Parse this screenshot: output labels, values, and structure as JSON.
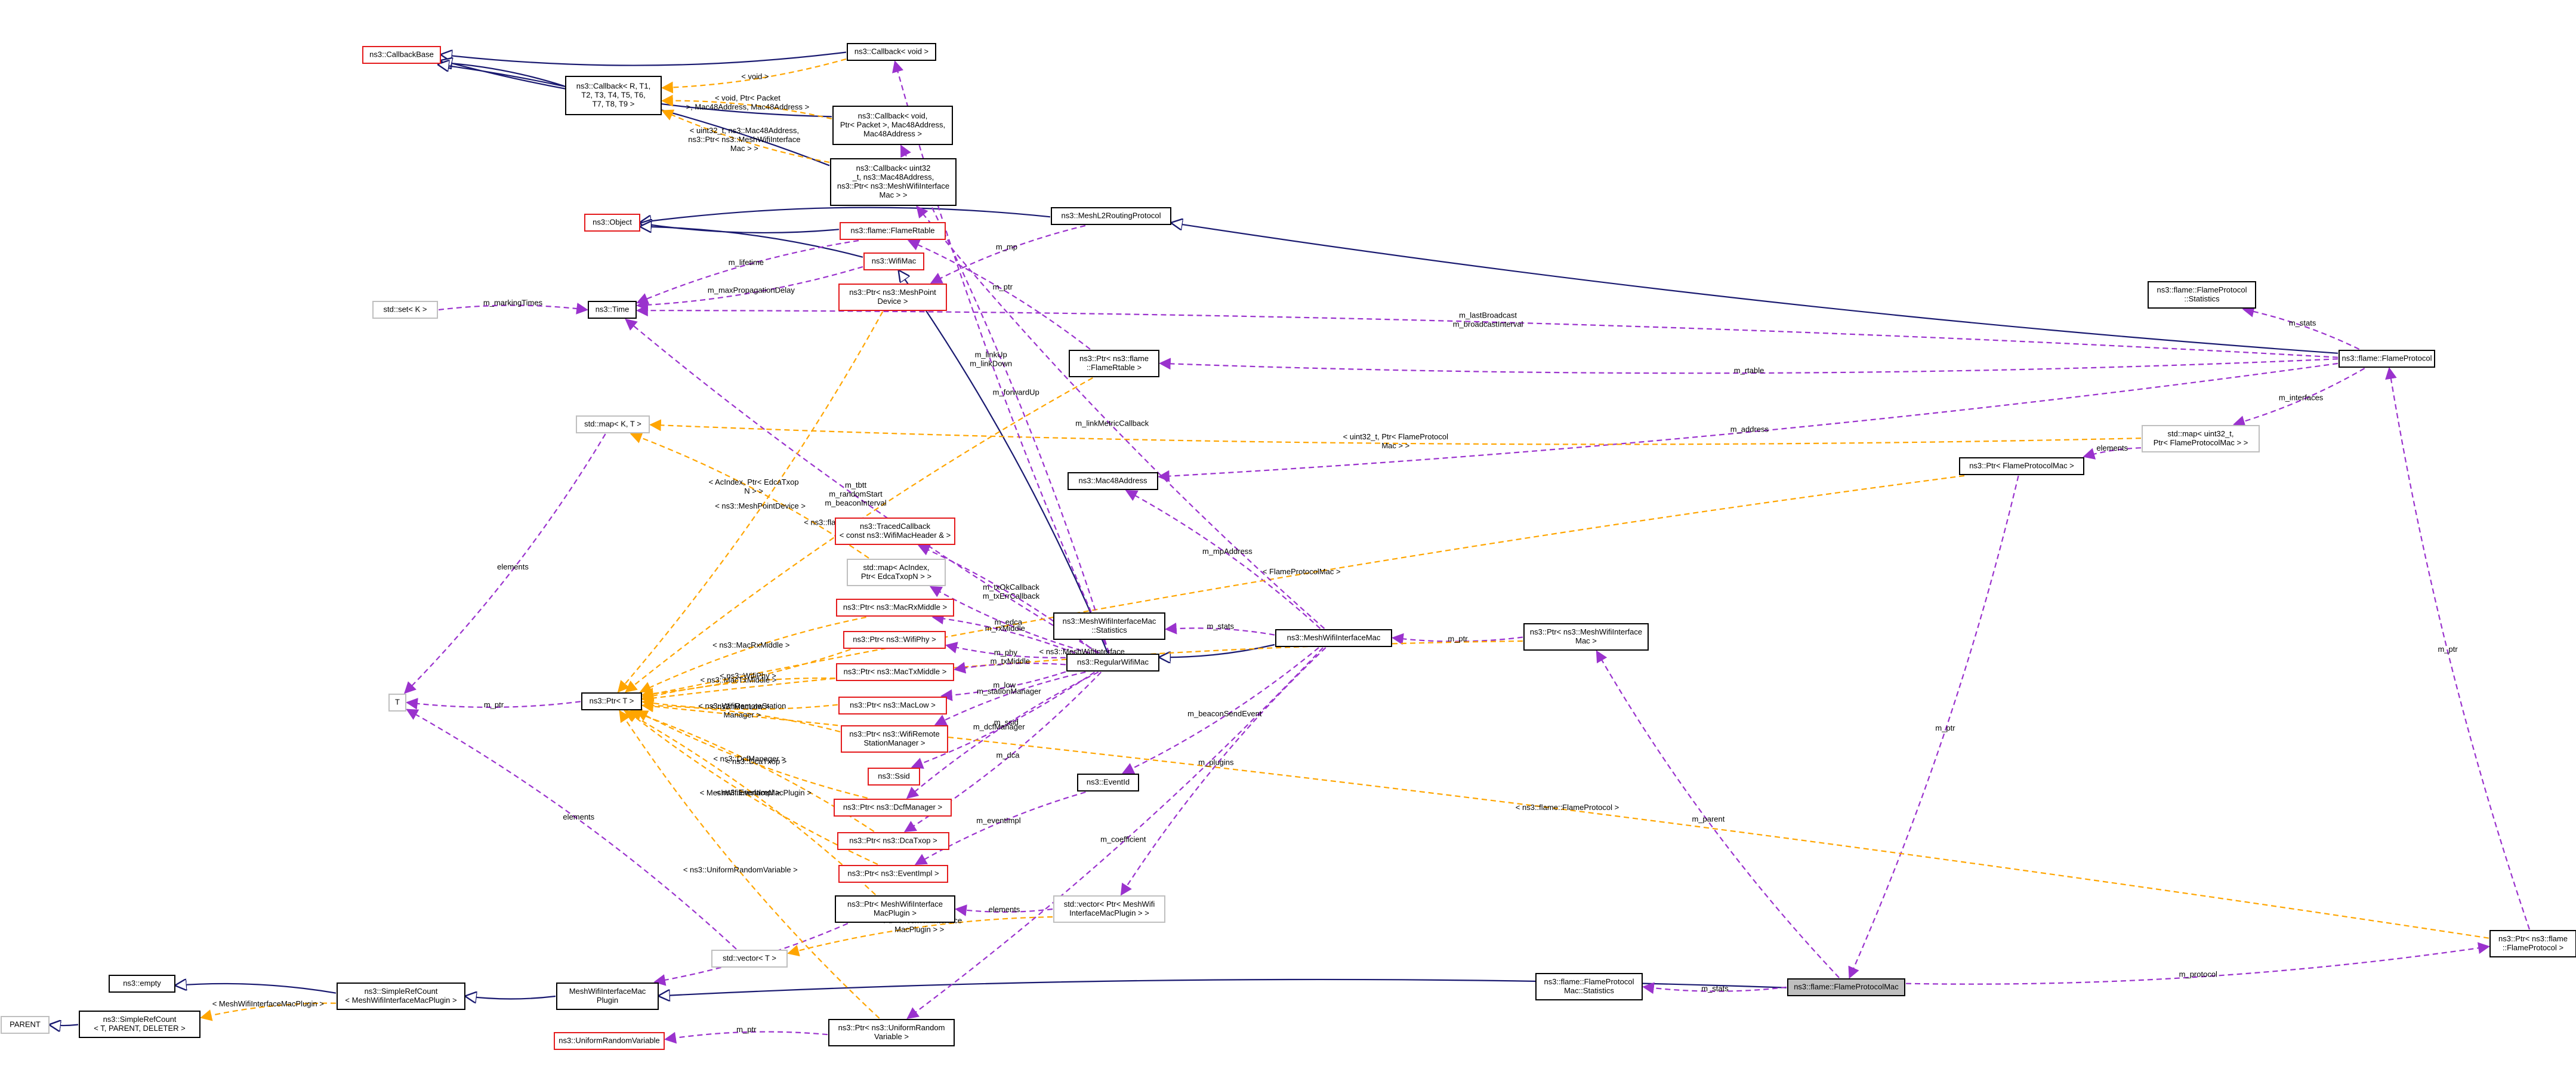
{
  "colors": {
    "inheritance": "#191970",
    "usage": "#9a32cd",
    "template": "#ffa500",
    "box_border": "#000000",
    "box_border_undocumented": "#e41a1c",
    "box_border_external": "#bfbfbf",
    "focus_fill": "#bfbfbf"
  },
  "nodes": [
    {
      "id": "CallbackBase",
      "style": "red",
      "lines": [
        "ns3::CallbackBase"
      ]
    },
    {
      "id": "CallbackVoid",
      "style": "black",
      "lines": [
        "ns3::Callback< void >"
      ]
    },
    {
      "id": "CallbackTemplate",
      "style": "black",
      "lines": [
        "ns3::Callback< R, T1,",
        "T2, T3, T4, T5, T6,",
        "T7, T8, T9 >"
      ]
    },
    {
      "id": "CallbackPacket",
      "style": "black",
      "lines": [
        "ns3::Callback< void,",
        "Ptr< Packet >, Mac48Address,",
        "Mac48Address >"
      ]
    },
    {
      "id": "CallbackUint32",
      "style": "black",
      "lines": [
        "ns3::Callback< uint32",
        "_t, ns3::Mac48Address,",
        "ns3::Ptr< ns3::MeshWifiInterface",
        "Mac > >"
      ]
    },
    {
      "id": "Object",
      "style": "red",
      "lines": [
        "ns3::Object"
      ]
    },
    {
      "id": "FlameRtable",
      "style": "red",
      "lines": [
        "ns3::flame::FlameRtable"
      ]
    },
    {
      "id": "WifiMac",
      "style": "red",
      "lines": [
        "ns3::WifiMac"
      ]
    },
    {
      "id": "MeshL2RoutingProtocol",
      "style": "black",
      "lines": [
        "ns3::MeshL2RoutingProtocol"
      ]
    },
    {
      "id": "FlameProtocolStatistics",
      "style": "black",
      "lines": [
        "ns3::flame::FlameProtocol",
        "::Statistics"
      ]
    },
    {
      "id": "PtrMeshPointDevice",
      "style": "red",
      "lines": [
        "ns3::Ptr< ns3::MeshPoint",
        "Device >"
      ]
    },
    {
      "id": "SetK",
      "style": "grey",
      "lines": [
        "std::set< K >"
      ]
    },
    {
      "id": "Time",
      "style": "black",
      "lines": [
        "ns3::Time"
      ]
    },
    {
      "id": "PtrFlameRtable",
      "style": "black",
      "lines": [
        "ns3::Ptr< ns3::flame",
        "::FlameRtable >"
      ]
    },
    {
      "id": "FlameProtocol",
      "style": "black",
      "lines": [
        "ns3::flame::FlameProtocol"
      ]
    },
    {
      "id": "MapKT",
      "style": "grey",
      "lines": [
        "std::map< K, T >"
      ]
    },
    {
      "id": "MapUint32",
      "style": "grey",
      "lines": [
        "std::map< uint32_t,",
        "Ptr< FlameProtocolMac > >"
      ]
    },
    {
      "id": "PtrFlameProtocolMac",
      "style": "black",
      "lines": [
        "ns3::Ptr< FlameProtocolMac >"
      ]
    },
    {
      "id": "Mac48Address",
      "style": "black",
      "lines": [
        "ns3::Mac48Address"
      ]
    },
    {
      "id": "TracedCallback",
      "style": "red",
      "lines": [
        "ns3::TracedCallback",
        "< const ns3::WifiMacHeader & >"
      ]
    },
    {
      "id": "MapAcIndex",
      "style": "grey",
      "lines": [
        "std::map< AcIndex,",
        "Ptr< EdcaTxopN > >"
      ]
    },
    {
      "id": "PtrMacRxMiddle",
      "style": "red",
      "lines": [
        "ns3::Ptr< ns3::MacRxMiddle >"
      ]
    },
    {
      "id": "MeshStats",
      "style": "black",
      "lines": [
        "ns3::MeshWifiInterfaceMac",
        "::Statistics"
      ]
    },
    {
      "id": "MeshWifiInterfaceMac",
      "style": "black",
      "lines": [
        "ns3::MeshWifiInterfaceMac"
      ]
    },
    {
      "id": "PtrMeshWifiInterfaceMac",
      "style": "black",
      "lines": [
        "ns3::Ptr< ns3::MeshWifiInterface",
        "Mac >"
      ]
    },
    {
      "id": "PtrWifiPhy",
      "style": "red",
      "lines": [
        "ns3::Ptr< ns3::WifiPhy >"
      ]
    },
    {
      "id": "RegularWifiMac",
      "style": "black",
      "lines": [
        "ns3::RegularWifiMac"
      ]
    },
    {
      "id": "PtrMacTxMiddle",
      "style": "red",
      "lines": [
        "ns3::Ptr< ns3::MacTxMiddle >"
      ]
    },
    {
      "id": "T",
      "style": "grey",
      "lines": [
        "T"
      ]
    },
    {
      "id": "PtrT",
      "style": "black",
      "lines": [
        "ns3::Ptr< T >"
      ]
    },
    {
      "id": "PtrMacLow",
      "style": "red",
      "lines": [
        "ns3::Ptr< ns3::MacLow >"
      ]
    },
    {
      "id": "PtrWifiRemote",
      "style": "red",
      "lines": [
        "ns3::Ptr< ns3::WifiRemote",
        "StationManager >"
      ]
    },
    {
      "id": "Ssid",
      "style": "red",
      "lines": [
        "ns3::Ssid"
      ]
    },
    {
      "id": "EventId",
      "style": "black",
      "lines": [
        "ns3::EventId"
      ]
    },
    {
      "id": "PtrDcfManager",
      "style": "red",
      "lines": [
        "ns3::Ptr< ns3::DcfManager >"
      ]
    },
    {
      "id": "PtrDcaTxop",
      "style": "red",
      "lines": [
        "ns3::Ptr< ns3::DcaTxop >"
      ]
    },
    {
      "id": "PtrEventImpl",
      "style": "red",
      "lines": [
        "ns3::Ptr< ns3::EventImpl >"
      ]
    },
    {
      "id": "PtrMeshPlugin",
      "style": "black",
      "lines": [
        "ns3::Ptr< MeshWifiInterface",
        "MacPlugin >"
      ]
    },
    {
      "id": "VectorPtrPlugin",
      "style": "grey",
      "lines": [
        "std::vector< Ptr< MeshWifi",
        "InterfaceMacPlugin > >"
      ]
    },
    {
      "id": "VectorT",
      "style": "grey",
      "lines": [
        "std::vector< T >"
      ]
    },
    {
      "id": "PtrFlameProtocol",
      "style": "black",
      "lines": [
        "ns3::Ptr< ns3::flame",
        "::FlameProtocol >"
      ]
    },
    {
      "id": "Empty",
      "style": "black",
      "lines": [
        "ns3::empty"
      ]
    },
    {
      "id": "SimpleRefCountPlugin",
      "style": "black",
      "lines": [
        "ns3::SimpleRefCount",
        "< MeshWifiInterfaceMacPlugin >"
      ]
    },
    {
      "id": "MeshPlugin",
      "style": "black",
      "lines": [
        "MeshWifiInterfaceMac",
        "Plugin"
      ]
    },
    {
      "id": "FlameMacStats",
      "style": "black",
      "lines": [
        "ns3::flame::FlameProtocol",
        "Mac::Statistics"
      ]
    },
    {
      "id": "FlameProtocolMac",
      "style": "focus",
      "lines": [
        "ns3::flame::FlameProtocolMac"
      ]
    },
    {
      "id": "Parent",
      "style": "grey",
      "lines": [
        "PARENT"
      ]
    },
    {
      "id": "SimpleRefCountTPD",
      "style": "black",
      "lines": [
        "ns3::SimpleRefCount",
        "< T, PARENT, DELETER >"
      ]
    },
    {
      "id": "PtrUniformRandom",
      "style": "black",
      "lines": [
        "ns3::Ptr< ns3::UniformRandom",
        "Variable >"
      ]
    },
    {
      "id": "UniformRandomVariable",
      "style": "red",
      "lines": [
        "ns3::UniformRandomVariable"
      ]
    }
  ],
  "edges": [
    {
      "from": "CallbackVoid",
      "to": "CallbackBase",
      "kind": "inherit",
      "label": []
    },
    {
      "from": "CallbackTemplate",
      "to": "CallbackBase",
      "kind": "inherit",
      "label": []
    },
    {
      "from": "CallbackPacket",
      "to": "CallbackBase",
      "kind": "inherit",
      "label": []
    },
    {
      "from": "CallbackUint32",
      "to": "CallbackBase",
      "kind": "inherit",
      "label": []
    },
    {
      "from": "CallbackVoid",
      "to": "CallbackTemplate",
      "kind": "template",
      "label": [
        "< void >"
      ]
    },
    {
      "from": "CallbackPacket",
      "to": "CallbackTemplate",
      "kind": "template",
      "label": [
        "< void, Ptr< Packet",
        ">, Mac48Address, Mac48Address >"
      ]
    },
    {
      "from": "CallbackUint32",
      "to": "CallbackTemplate",
      "kind": "template",
      "label": [
        "< uint32_t, ns3::Mac48Address,",
        "ns3::Ptr< ns3::MeshWifiInterface",
        "Mac > >"
      ]
    },
    {
      "from": "MeshL2RoutingProtocol",
      "to": "Object",
      "kind": "inherit",
      "label": []
    },
    {
      "from": "FlameRtable",
      "to": "Object",
      "kind": "inherit",
      "label": []
    },
    {
      "from": "WifiMac",
      "to": "Object",
      "kind": "inherit",
      "label": []
    },
    {
      "from": "FlameProtocol",
      "to": "MeshL2RoutingProtocol",
      "kind": "inherit",
      "label": []
    },
    {
      "from": "RegularWifiMac",
      "to": "WifiMac",
      "kind": "inherit",
      "label": []
    },
    {
      "from": "MeshWifiInterfaceMac",
      "to": "RegularWifiMac",
      "kind": "inherit",
      "label": []
    },
    {
      "from": "FlameProtocolMac",
      "to": "MeshPlugin",
      "kind": "inherit",
      "label": []
    },
    {
      "from": "MeshPlugin",
      "to": "SimpleRefCountPlugin",
      "kind": "inherit",
      "label": []
    },
    {
      "from": "SimpleRefCountPlugin",
      "to": "Empty",
      "kind": "inherit",
      "label": []
    },
    {
      "from": "SimpleRefCountTPD",
      "to": "Parent",
      "kind": "inherit",
      "label": []
    },
    {
      "from": "SimpleRefCountPlugin",
      "to": "SimpleRefCountTPD",
      "kind": "template",
      "label": [
        "< MeshWifiInterfaceMacPlugin >"
      ]
    },
    {
      "from": "WifiMac",
      "to": "Time",
      "kind": "usage",
      "label": [
        "m_maxPropagationDelay"
      ]
    },
    {
      "from": "FlameRtable",
      "to": "Time",
      "kind": "usage",
      "label": [
        "m_lifetime"
      ]
    },
    {
      "from": "SetK",
      "to": "Time",
      "kind": "usage",
      "label": [
        "m_markingTimes"
      ]
    },
    {
      "from": "FlameProtocol",
      "to": "Time",
      "kind": "usage",
      "label": [
        "m_lastBroadcast",
        "m_broadcastInterval"
      ]
    },
    {
      "from": "RegularWifiMac",
      "to": "Time",
      "kind": "usage",
      "label": [
        "m_tbtt",
        "m_randomStart",
        "m_beaconInterval"
      ]
    },
    {
      "from": "FlameProtocol",
      "to": "FlameProtocolStatistics",
      "kind": "usage",
      "label": [
        "m_stats"
      ]
    },
    {
      "from": "FlameProtocol",
      "to": "PtrFlameRtable",
      "kind": "usage",
      "label": [
        "m_rtable"
      ]
    },
    {
      "from": "PtrFlameRtable",
      "to": "FlameRtable",
      "kind": "usage",
      "label": [
        "m_ptr"
      ]
    },
    {
      "from": "FlameProtocol",
      "to": "Mac48Address",
      "kind": "usage",
      "label": [
        "m_address"
      ]
    },
    {
      "from": "MeshWifiInterfaceMac",
      "to": "Mac48Address",
      "kind": "usage",
      "label": [
        "m_mpAddress"
      ]
    },
    {
      "from": "FlameProtocol",
      "to": "MapUint32",
      "kind": "usage",
      "label": [
        "m_interfaces"
      ]
    },
    {
      "from": "MapUint32",
      "to": "PtrFlameProtocolMac",
      "kind": "usage",
      "label": [
        "elements"
      ]
    },
    {
      "from": "MapUint32",
      "to": "MapKT",
      "kind": "template",
      "label": [
        "< uint32_t, Ptr< FlameProtocol",
        "Mac > >"
      ]
    },
    {
      "from": "PtrFlameProtocolMac",
      "to": "PtrT",
      "kind": "template",
      "label": [
        "< FlameProtocolMac >"
      ]
    },
    {
      "from": "PtrFlameProtocolMac",
      "to": "FlameProtocolMac",
      "kind": "usage",
      "label": [
        "m_ptr"
      ]
    },
    {
      "from": "MeshL2RoutingProtocol",
      "to": "PtrMeshPointDevice",
      "kind": "usage",
      "label": [
        "m_mp"
      ]
    },
    {
      "from": "PtrMeshPointDevice",
      "to": "PtrT",
      "kind": "template",
      "label": [
        "< ns3::MeshPointDevice >"
      ]
    },
    {
      "from": "PtrFlameRtable",
      "to": "PtrT",
      "kind": "template",
      "label": [
        "< ns3::flame::FlameRtable >"
      ]
    },
    {
      "from": "MapKT",
      "to": "T",
      "kind": "usage",
      "label": [
        "elements"
      ]
    },
    {
      "from": "MapAcIndex",
      "to": "MapKT",
      "kind": "template",
      "label": [
        "< AcIndex, Ptr< EdcaTxop",
        "N > >"
      ]
    },
    {
      "from": "RegularWifiMac",
      "to": "MapAcIndex",
      "kind": "usage",
      "label": [
        "m_edca"
      ]
    },
    {
      "from": "RegularWifiMac",
      "to": "TracedCallback",
      "kind": "usage",
      "label": [
        "m_txOkCallback",
        "m_txErrCallback"
      ]
    },
    {
      "from": "RegularWifiMac",
      "to": "CallbackVoid",
      "kind": "usage",
      "label": [
        "m_linkUp",
        "m_linkDown"
      ]
    },
    {
      "from": "RegularWifiMac",
      "to": "CallbackPacket",
      "kind": "usage",
      "label": [
        "m_forwardUp"
      ]
    },
    {
      "from": "MeshWifiInterfaceMac",
      "to": "CallbackUint32",
      "kind": "usage",
      "label": [
        "m_linkMetricCallback"
      ]
    },
    {
      "from": "MeshWifiInterfaceMac",
      "to": "MeshStats",
      "kind": "usage",
      "label": [
        "m_stats"
      ]
    },
    {
      "from": "PtrMeshWifiInterfaceMac",
      "to": "MeshWifiInterfaceMac",
      "kind": "usage",
      "label": [
        "m_ptr"
      ]
    },
    {
      "from": "PtrMeshWifiInterfaceMac",
      "to": "PtrT",
      "kind": "template",
      "label": [
        "< ns3::MeshWifiInterface",
        "Mac >"
      ]
    },
    {
      "from": "FlameProtocolMac",
      "to": "PtrMeshWifiInterfaceMac",
      "kind": "usage",
      "label": [
        "m_parent"
      ]
    },
    {
      "from": "RegularWifiMac",
      "to": "PtrMacRxMiddle",
      "kind": "usage",
      "label": [
        "m_rxMiddle"
      ]
    },
    {
      "from": "RegularWifiMac",
      "to": "PtrWifiPhy",
      "kind": "usage",
      "label": [
        "m_phy"
      ]
    },
    {
      "from": "RegularWifiMac",
      "to": "PtrMacTxMiddle",
      "kind": "usage",
      "label": [
        "m_txMiddle"
      ]
    },
    {
      "from": "RegularWifiMac",
      "to": "PtrMacLow",
      "kind": "usage",
      "label": [
        "m_low"
      ]
    },
    {
      "from": "RegularWifiMac",
      "to": "PtrWifiRemote",
      "kind": "usage",
      "label": [
        "m_stationManager"
      ]
    },
    {
      "from": "RegularWifiMac",
      "to": "Ssid",
      "kind": "usage",
      "label": [
        "m_ssid"
      ]
    },
    {
      "from": "RegularWifiMac",
      "to": "PtrDcfManager",
      "kind": "usage",
      "label": [
        "m_dcfManager"
      ]
    },
    {
      "from": "RegularWifiMac",
      "to": "PtrDcaTxop",
      "kind": "usage",
      "label": [
        "m_dca"
      ]
    },
    {
      "from": "EventId",
      "to": "PtrEventImpl",
      "kind": "usage",
      "label": [
        "m_eventImpl"
      ]
    },
    {
      "from": "MeshWifiInterfaceMac",
      "to": "EventId",
      "kind": "usage",
      "label": [
        "m_beaconSendEvent"
      ]
    },
    {
      "from": "MeshWifiInterfaceMac",
      "to": "VectorPtrPlugin",
      "kind": "usage",
      "label": [
        "m_plugins"
      ]
    },
    {
      "from": "VectorPtrPlugin",
      "to": "PtrMeshPlugin",
      "kind": "usage",
      "label": [
        "elements"
      ]
    },
    {
      "from": "VectorPtrPlugin",
      "to": "VectorT",
      "kind": "template",
      "label": [
        "< Ptr< MeshWifiInterface",
        "MacPlugin > >"
      ]
    },
    {
      "from": "MeshWifiInterfaceMac",
      "to": "PtrUniformRandom",
      "kind": "usage",
      "label": [
        "m_coefficient"
      ]
    },
    {
      "from": "PtrUniformRandom",
      "to": "UniformRandomVariable",
      "kind": "usage",
      "label": [
        "m_ptr"
      ]
    },
    {
      "from": "PtrMeshPlugin",
      "to": "MeshPlugin",
      "kind": "usage",
      "label": [
        "m_ptr"
      ]
    },
    {
      "from": "PtrMacRxMiddle",
      "to": "PtrT",
      "kind": "template",
      "label": [
        "< ns3::MacRxMiddle >"
      ]
    },
    {
      "from": "PtrWifiPhy",
      "to": "PtrT",
      "kind": "template",
      "label": [
        "< ns3::WifiPhy >"
      ]
    },
    {
      "from": "PtrMacTxMiddle",
      "to": "PtrT",
      "kind": "template",
      "label": [
        "< ns3::MacTxMiddle >"
      ]
    },
    {
      "from": "PtrMacLow",
      "to": "PtrT",
      "kind": "template",
      "label": [
        "< ns3::MacLow >"
      ]
    },
    {
      "from": "PtrWifiRemote",
      "to": "PtrT",
      "kind": "template",
      "label": [
        "< ns3::WifiRemoteStation",
        "Manager >"
      ]
    },
    {
      "from": "PtrDcfManager",
      "to": "PtrT",
      "kind": "template",
      "label": [
        "< ns3::DcfManager >"
      ]
    },
    {
      "from": "PtrDcaTxop",
      "to": "PtrT",
      "kind": "template",
      "label": [
        "< ns3::DcaTxop >"
      ]
    },
    {
      "from": "PtrEventImpl",
      "to": "PtrT",
      "kind": "template",
      "label": [
        "< ns3::EventImpl >"
      ]
    },
    {
      "from": "PtrMeshPlugin",
      "to": "PtrT",
      "kind": "template",
      "label": [
        "< MeshWifiInterfaceMacPlugin >"
      ]
    },
    {
      "from": "PtrUniformRandom",
      "to": "PtrT",
      "kind": "template",
      "label": [
        "< ns3::UniformRandomVariable >"
      ]
    },
    {
      "from": "PtrFlameProtocol",
      "to": "PtrT",
      "kind": "template",
      "label": [
        "< ns3::flame::FlameProtocol >"
      ]
    },
    {
      "from": "PtrT",
      "to": "T",
      "kind": "usage",
      "label": [
        "m_ptr"
      ]
    },
    {
      "from": "VectorT",
      "to": "T",
      "kind": "usage",
      "label": [
        "elements"
      ]
    },
    {
      "from": "FlameProtocolMac",
      "to": "FlameMacStats",
      "kind": "usage",
      "label": [
        "m_stats"
      ]
    },
    {
      "from": "FlameProtocolMac",
      "to": "PtrFlameProtocol",
      "kind": "usage",
      "label": [
        "m_protocol"
      ]
    },
    {
      "from": "PtrFlameProtocol",
      "to": "FlameProtocol",
      "kind": "usage",
      "label": [
        "m_ptr"
      ]
    }
  ]
}
